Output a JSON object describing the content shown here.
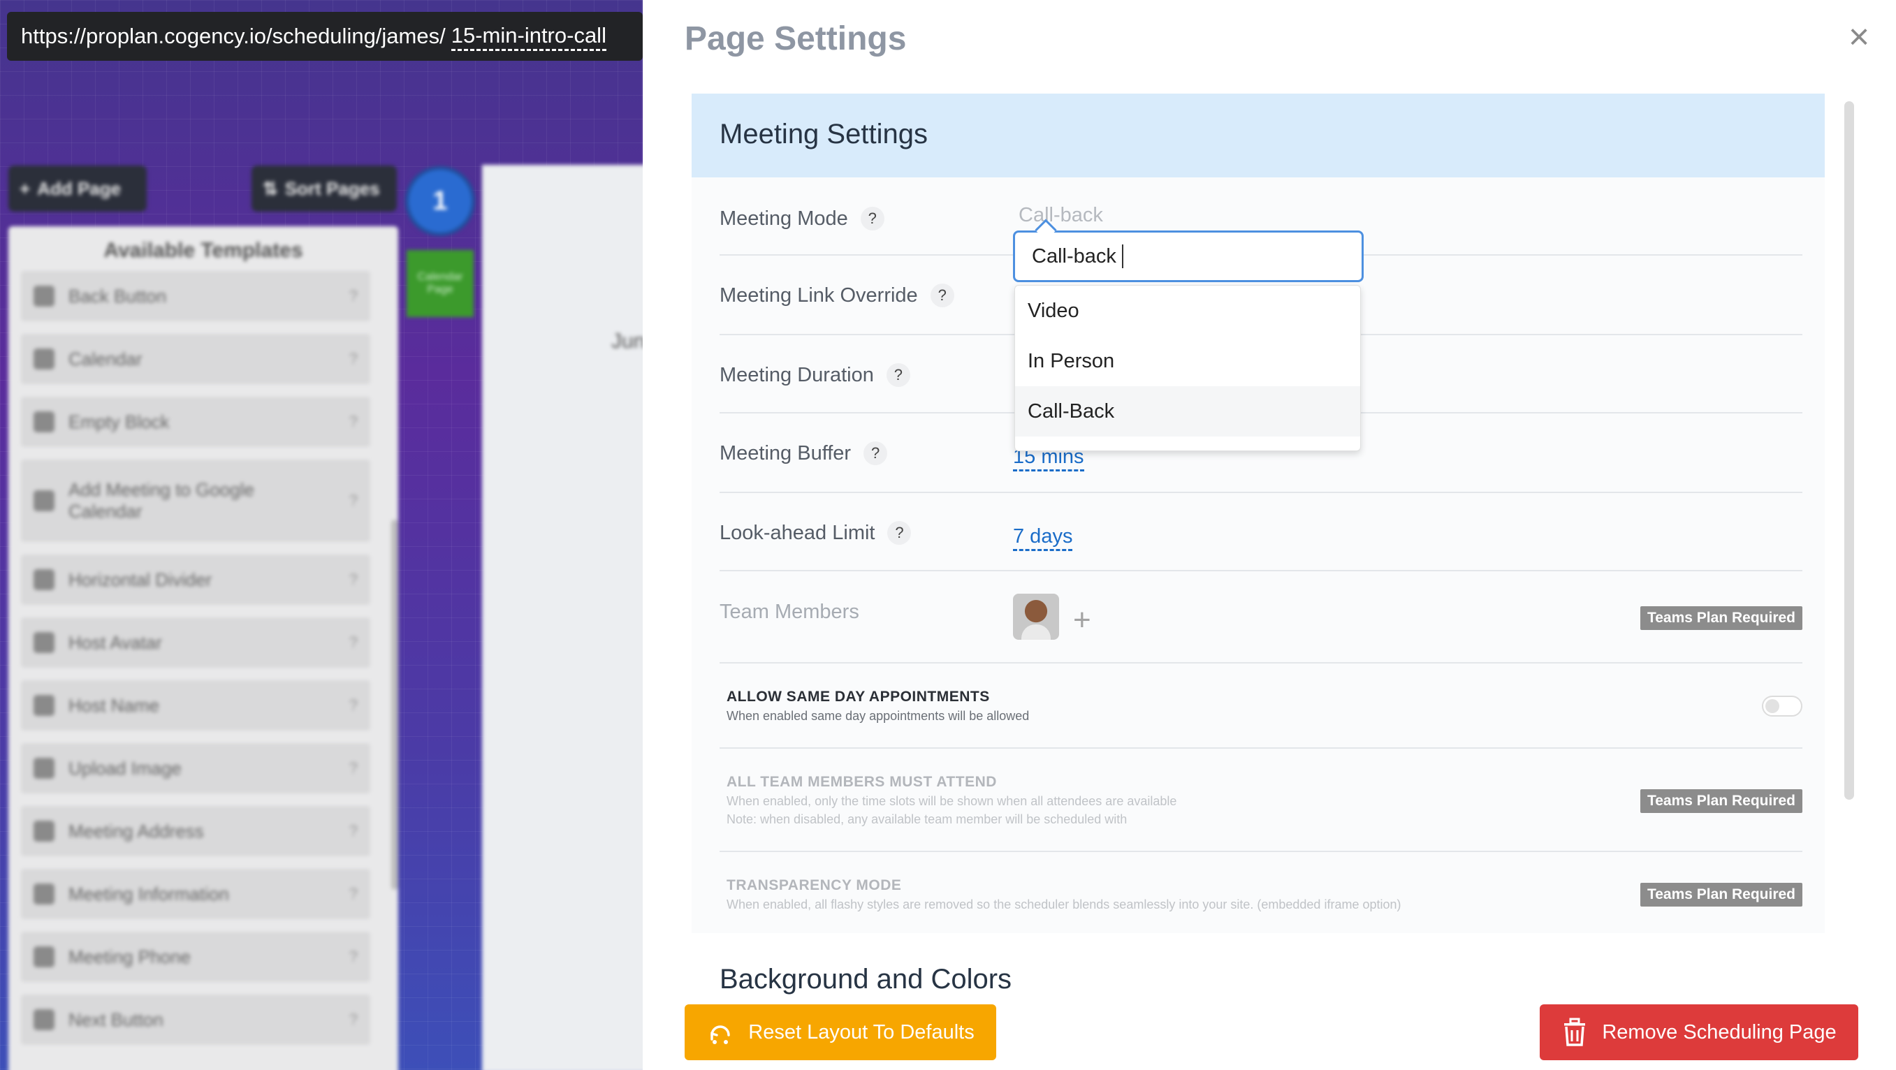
{
  "background": {
    "url_prefix": "https://proplan.cogency.io/scheduling/james/",
    "url_slug": "15-min-intro-call",
    "add_page_label": "Add Page",
    "sort_pages_label": "Sort Pages",
    "page_number": "1",
    "page_chip_label": "Calendar Page",
    "preview_text": "Jun",
    "templates_title": "Available Templates",
    "templates": [
      {
        "label": "Back Button",
        "icon": "chevron-left-icon"
      },
      {
        "label": "Calendar",
        "icon": "calendar-icon"
      },
      {
        "label": "Empty Block",
        "icon": "block-icon"
      },
      {
        "label": "Add Meeting to Google Calendar",
        "icon": "calendar-add-icon"
      },
      {
        "label": "Horizontal Divider",
        "icon": "divider-icon"
      },
      {
        "label": "Host Avatar",
        "icon": "avatar-icon"
      },
      {
        "label": "Host Name",
        "icon": "name-icon"
      },
      {
        "label": "Upload Image",
        "icon": "image-icon"
      },
      {
        "label": "Meeting Address",
        "icon": "location-icon"
      },
      {
        "label": "Meeting Information",
        "icon": "clock-icon"
      },
      {
        "label": "Meeting Phone",
        "icon": "phone-icon"
      },
      {
        "label": "Next Button",
        "icon": "next-icon"
      }
    ],
    "template_help": "?"
  },
  "panel": {
    "title": "Page Settings",
    "close_icon": "close-icon",
    "meeting_settings_title": "Meeting Settings",
    "rows": {
      "mode": {
        "label": "Meeting Mode",
        "help": "?"
      },
      "link": {
        "label": "Meeting Link Override",
        "help": "?"
      },
      "duration": {
        "label": "Meeting Duration",
        "help": "?"
      },
      "buffer": {
        "label": "Meeting Buffer",
        "help": "?",
        "value": "15 mins"
      },
      "lookahead": {
        "label": "Look-ahead Limit",
        "help": "?",
        "value": "7 days"
      },
      "team": {
        "label": "Team Members",
        "badge": "Teams Plan Required",
        "add_symbol": "+"
      }
    },
    "options": {
      "same_day": {
        "title": "ALLOW SAME DAY APPOINTMENTS",
        "desc": "When enabled same day appointments will be allowed"
      },
      "all_attend": {
        "title": "ALL TEAM MEMBERS MUST ATTEND",
        "desc1": "When enabled, only the time slots will be shown when all attendees are available",
        "desc2": "Note: when disabled, any available team member will be scheduled with",
        "badge": "Teams Plan Required"
      },
      "transparency": {
        "title": "TRANSPARENCY MODE",
        "desc": "When enabled, all flashy styles are removed so the scheduler blends seamlessly into your site. (embedded iframe option)",
        "badge": "Teams Plan Required"
      }
    },
    "bg_colors_title": "Background and Colors",
    "dropdown": {
      "current": "Call-back",
      "input_value": "Call-back",
      "options": [
        "Video",
        "In Person",
        "Call-Back"
      ],
      "highlighted": "Call-Back"
    },
    "buttons": {
      "reset": "Reset Layout To Defaults",
      "remove": "Remove Scheduling Page"
    }
  },
  "colors": {
    "header_bg": "#d8ebfb",
    "link": "#1a6cc8",
    "reset_btn": "#f7a600",
    "remove_btn": "#dd3b3b",
    "focus_border": "#4d90e0"
  }
}
